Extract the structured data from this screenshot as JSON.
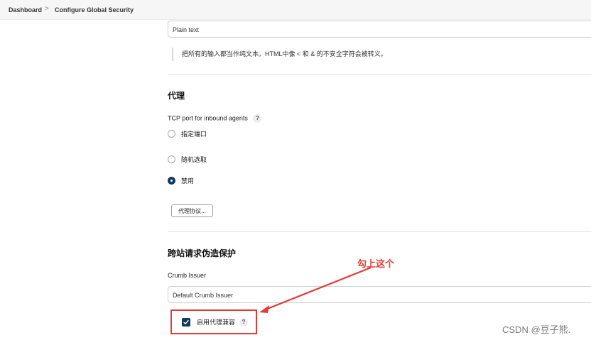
{
  "breadcrumb": {
    "items": [
      "Dashboard",
      "Configure Global Security"
    ],
    "separator": ">"
  },
  "markup": {
    "formatter_value": "Plain text",
    "description": "把所有的输入都当作纯文本。HTML中像 < 和 & 的不安全字符会被转义。"
  },
  "proxy_section": {
    "title": "代理",
    "tcp_label": "TCP port for inbound agents",
    "radios": [
      {
        "label": "指定端口",
        "checked": false
      },
      {
        "label": "随机选取",
        "checked": false
      },
      {
        "label": "禁用",
        "checked": true
      }
    ],
    "protocol_button": "代理协议..."
  },
  "csrf_section": {
    "title": "跨站请求伪造保护",
    "crumb_label": "Crumb Issuer",
    "crumb_value": "Default Crumb Issuer",
    "checkbox_label": "启用代理兼容",
    "checkbox_checked": true
  },
  "help_glyph": "?",
  "annotation": {
    "text": "勾上这个",
    "color": "#e23b36"
  },
  "watermark": "CSDN @豆子熊.",
  "colors": {
    "accent": "#123a5c",
    "annotation_red": "#e23b36"
  }
}
